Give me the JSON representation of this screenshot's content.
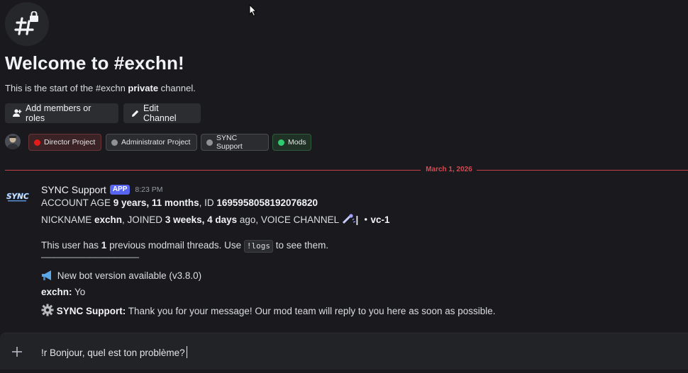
{
  "header": {
    "icon": "hash-lock-icon",
    "welcome": "Welcome to #exchn!",
    "intro_prefix": "This is the start of the #exchn ",
    "intro_bold": "private",
    "intro_suffix": " channel."
  },
  "actions": {
    "add_members": "Add members or roles",
    "edit_channel": "Edit Channel"
  },
  "roles": [
    {
      "label": "Director Project",
      "color": "#e31b1b"
    },
    {
      "label": "Administrator Project",
      "color": "#8e9297"
    },
    {
      "label": "SYNC Support",
      "color": "#8e9297"
    },
    {
      "label": "Mods",
      "color": "#2ecc71"
    }
  ],
  "divider": {
    "date": "March 1, 2026"
  },
  "message": {
    "author": "SYNC Support",
    "badge": "APP",
    "time": "8:23 PM",
    "account_age_label": "ACCOUNT AGE ",
    "account_age_value": "9 years, 11 months",
    "id_label": ", ID ",
    "id_value": "1695958058192076820",
    "nickname_label": "NICKNAME ",
    "nickname_value": "exchn",
    "joined_label": ", JOINED ",
    "joined_value": "3 weeks, 4 days",
    "joined_suffix": " ago, VOICE CHANNEL ",
    "voice_channel": "| ・vc-1",
    "threads_prefix": "This user has ",
    "threads_count": "1",
    "threads_mid": " previous modmail threads. Use ",
    "threads_cmd": "!logs",
    "threads_suffix": " to see them.",
    "separator": "────────────────",
    "bot_version": "New bot version available (v3.8.0)",
    "user_name": "exchn:",
    "user_text": " Yo",
    "reply_name": "SYNC Support:",
    "reply_text": " Thank you for your message! Our mod team will reply to you here as soon as possible."
  },
  "composer": {
    "value": "!r Bonjour, quel est ton problème?"
  }
}
